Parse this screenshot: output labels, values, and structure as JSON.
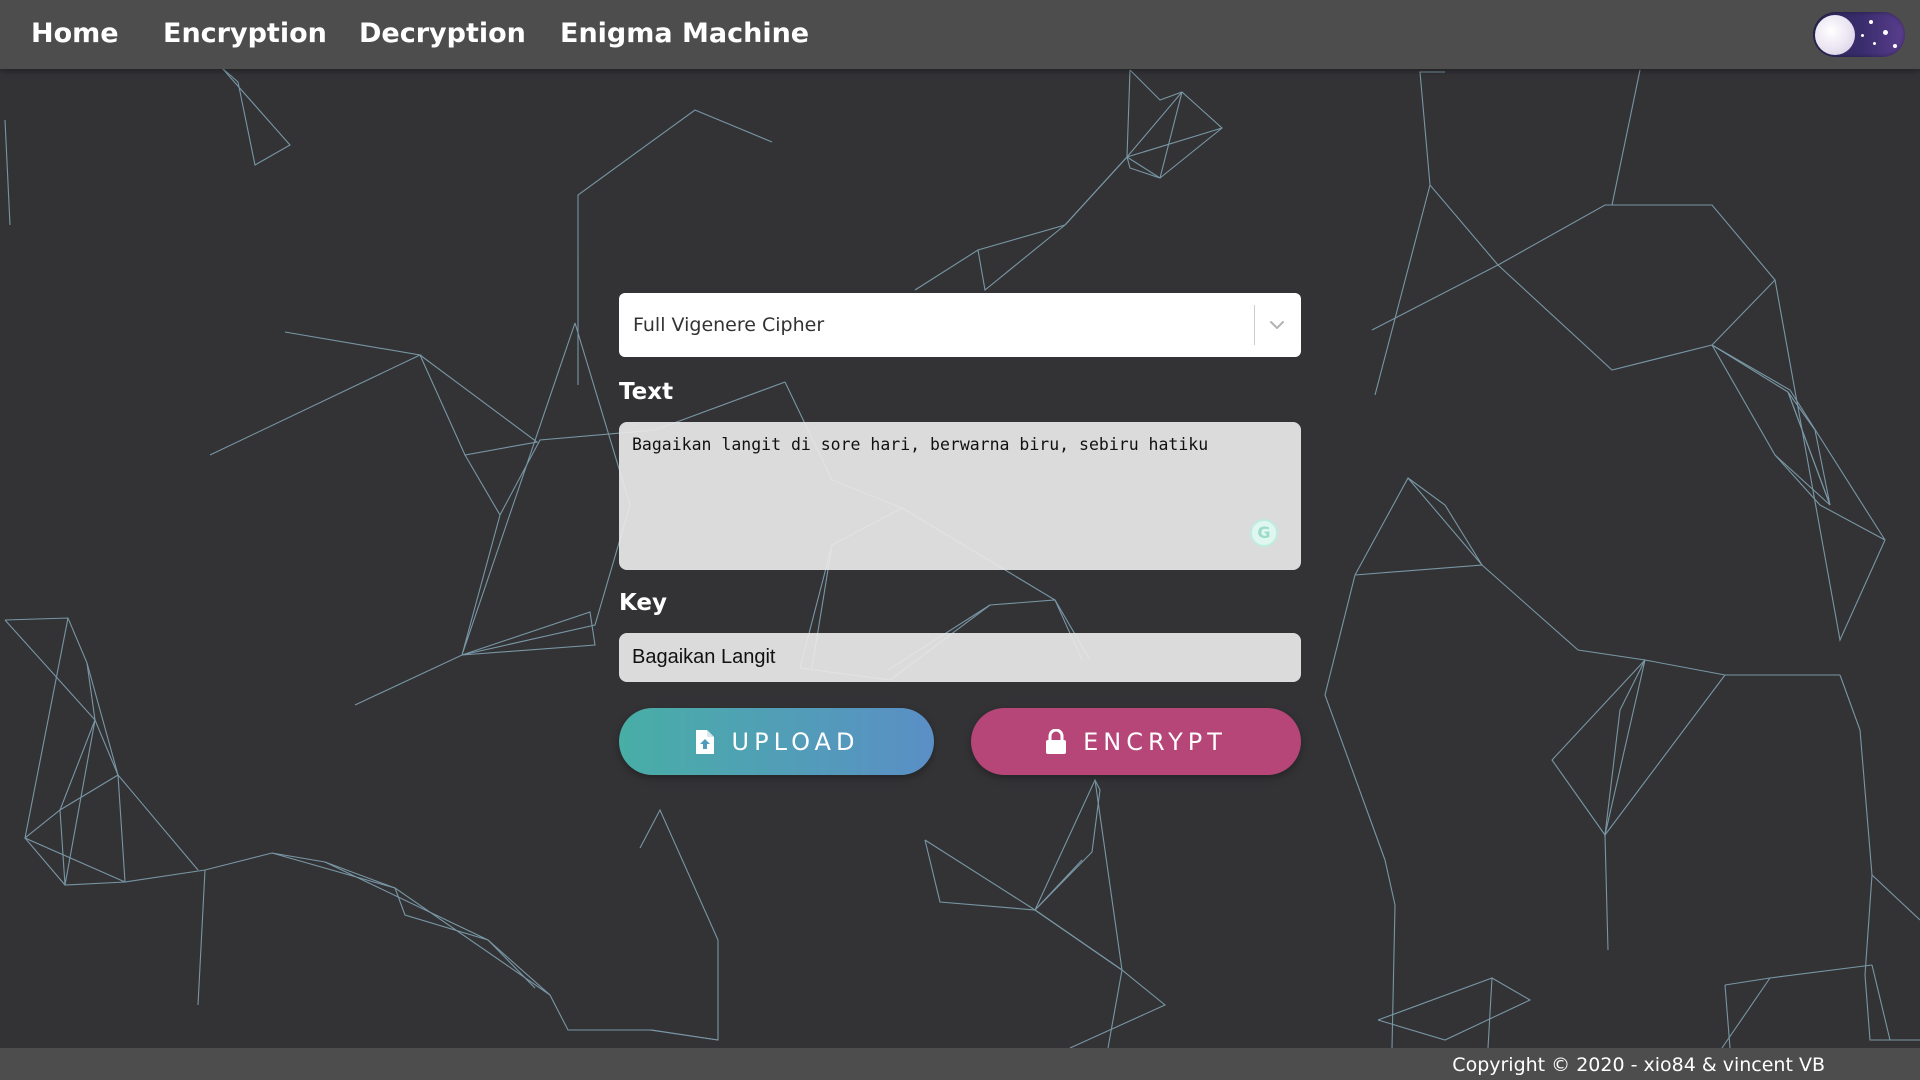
{
  "nav": {
    "items": [
      {
        "label": "Home"
      },
      {
        "label": "Encryption"
      },
      {
        "label": "Decryption"
      },
      {
        "label": "Enigma Machine"
      }
    ]
  },
  "form": {
    "cipher_selected": "Full Vigenere Cipher",
    "text_label": "Text",
    "text_value": "Bagaikan langit di sore hari, berwarna biru, sebiru hatiku",
    "key_label": "Key",
    "key_value": "Bagaikan Langit"
  },
  "buttons": {
    "upload_label": "UPLOAD",
    "encrypt_label": "ENCRYPT"
  },
  "icons": {
    "theme_toggle": "moon-toggle-icon",
    "dropdown": "chevron-down-icon",
    "upload": "file-upload-icon",
    "encrypt": "lock-icon",
    "grammarly": "grammarly-icon"
  },
  "colors": {
    "background": "#333336",
    "navbar": "#4d4d4d",
    "upload_gradient_start": "#48aea6",
    "upload_gradient_end": "#5a8fc6",
    "encrypt": "#b64578",
    "network_lines": "#8fb7c9"
  },
  "footer": {
    "copyright": "Copyright © 2020 - xio84 & vincent VB"
  }
}
